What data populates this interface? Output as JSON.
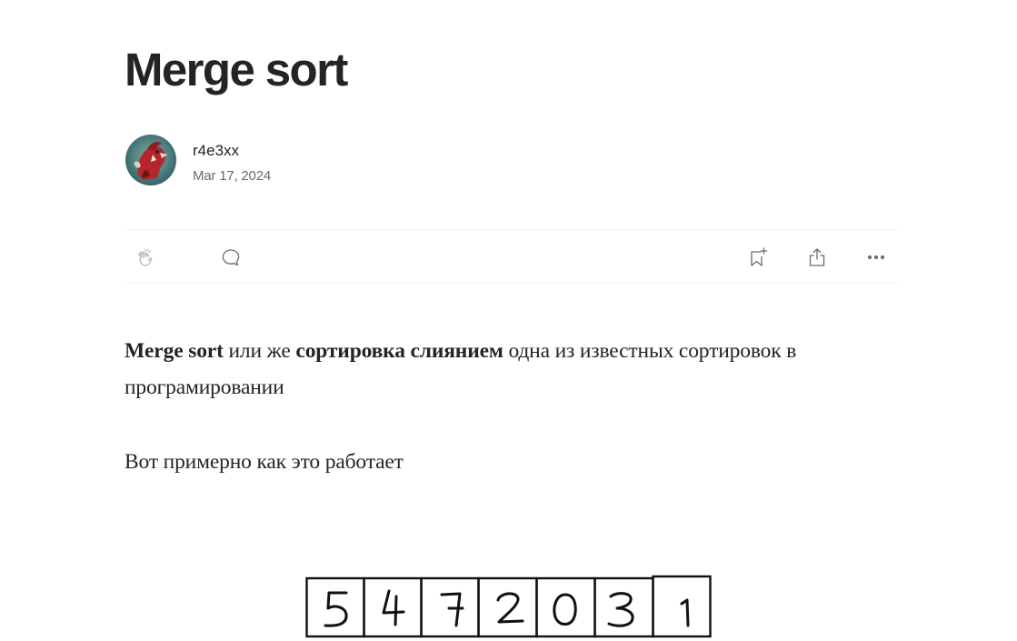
{
  "article": {
    "title": "Merge sort"
  },
  "author": {
    "name": "r4e3xx",
    "date": "Mar 17, 2024",
    "avatar_icon": "dragon-avatar"
  },
  "actions": {
    "clap_icon": "clap-icon",
    "response_icon": "comment-icon",
    "bookmark_icon": "bookmark-add-icon",
    "share_icon": "share-icon",
    "more_icon": "more-icon"
  },
  "content": {
    "p1_bold1": "Merge sort",
    "p1_text1": " или же ",
    "p1_bold2": "сортировка слиянием",
    "p1_text2": " одна из известных сортировок в програмировании",
    "p2": "Вот примерно как это работает"
  },
  "figure": {
    "digits": [
      "5",
      "4",
      "7",
      "2",
      "0",
      "3",
      "1"
    ]
  }
}
